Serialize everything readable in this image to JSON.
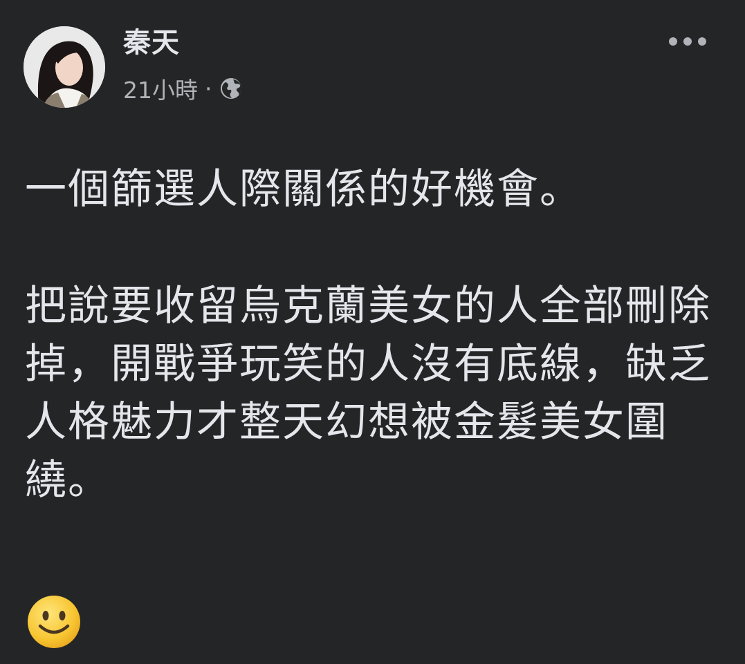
{
  "post": {
    "author": "秦天",
    "time": "21小時",
    "separator": "·",
    "audience_icon": "globe-icon",
    "more_icon": "more-horizontal-icon",
    "paragraphs": [
      "一個篩選人際關係的好機會。",
      "把說要收留烏克蘭美女的人全部刪除掉，開戰爭玩笑的人沒有底線，缺乏人格魅力才整天幻想被金髮美女圍繞。"
    ],
    "emoji": "smiling-face-emoji"
  },
  "colors": {
    "background": "#242526",
    "primary_text": "#e4e6eb",
    "secondary_text": "#b0b3b8",
    "emoji_yellow": "#f7c531"
  }
}
